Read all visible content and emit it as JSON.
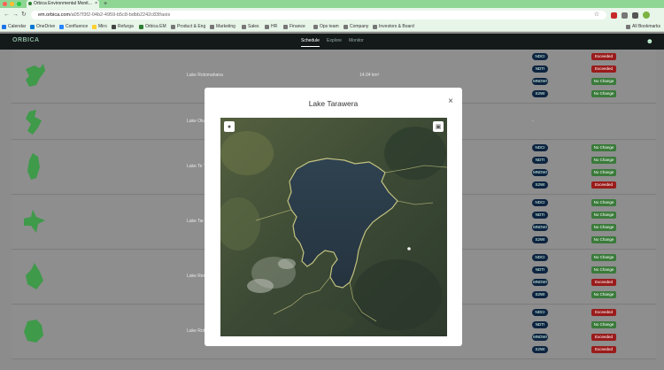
{
  "browser": {
    "tab_title": "Orbica Environmental Monit...",
    "new_tab": "+",
    "url_host": "em.orbica.com",
    "url_path": "/a057f3f2-04b2-4959-b5c8-bdbb2242c83f/aois",
    "bookmarks": [
      "Calendar",
      "OneDrive",
      "Confluence",
      "Miro",
      "Refurga",
      "Orbica EM",
      "Product & Eng",
      "Marketing",
      "Sales",
      "HR",
      "Finance",
      "Ops team",
      "Company",
      "Investors & Board"
    ],
    "all_bookmarks": "All Bookmarks"
  },
  "app": {
    "logo": "ORBICA",
    "nav": [
      "Schedule",
      "Explore",
      "Monitor"
    ]
  },
  "rows": [
    {
      "name": "Lake Rotomahana",
      "area": "14.04 km²",
      "indicators": [
        "NDCI",
        "NDTI",
        "MNDWI",
        "S2WI"
      ],
      "statuses": [
        "Exceeded",
        "Exceeded",
        "No Change",
        "No Change"
      ]
    },
    {
      "name": "Lake Oku",
      "area": "",
      "indicators": [],
      "statuses": [],
      "dash": "-"
    },
    {
      "name": "Lake Te T",
      "area": "",
      "indicators": [
        "NDCI",
        "NDTI",
        "MNDWI",
        "S2WI"
      ],
      "statuses": [
        "No Change",
        "No Change",
        "No Change",
        "Exceeded"
      ]
    },
    {
      "name": "Lake Tar",
      "area": "",
      "indicators": [
        "NDCI",
        "NDTI",
        "MNDWI",
        "S2WI"
      ],
      "statuses": [
        "No Change",
        "No Change",
        "No Change",
        "No Change"
      ]
    },
    {
      "name": "Lake Rer",
      "area": "",
      "indicators": [
        "NDCI",
        "NDTI",
        "MNDWI",
        "S2WI"
      ],
      "statuses": [
        "No Change",
        "No Change",
        "Exceeded",
        "No Change"
      ]
    },
    {
      "name": "Lake Rot",
      "area": "",
      "indicators": [
        "NDCI",
        "NDTI",
        "MNDWI",
        "S2WI"
      ],
      "statuses": [
        "Exceeded",
        "No Change",
        "Exceeded",
        "Exceeded"
      ]
    }
  ],
  "modal": {
    "title": "Lake Tarawera",
    "close": "×"
  },
  "colors": {
    "exceeded": "#9a1b1b",
    "no_change": "#3a7a3a",
    "indicator_pill": "#0d2440",
    "lake_shape": "#3f9a4a"
  }
}
